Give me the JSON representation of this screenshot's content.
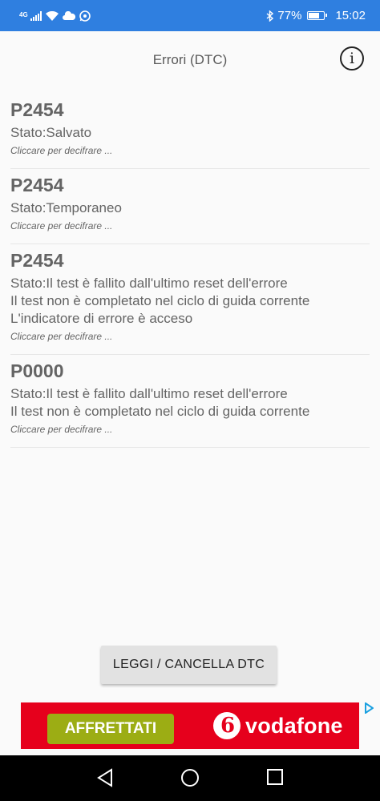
{
  "status_bar": {
    "network_tag": "4G",
    "battery_text": "77%",
    "battery_level": 0.77,
    "time": "15:02",
    "icons": [
      "signal-icon",
      "wifi-icon",
      "cloud-icon",
      "whatsapp-icon",
      "bluetooth-icon",
      "battery-icon"
    ]
  },
  "header": {
    "title": "Errori (DTC)",
    "info_icon": "i"
  },
  "dtc_list": [
    {
      "code": "P2454",
      "status_lines": [
        "Stato:Salvato"
      ],
      "hint": "Cliccare per decifrare ..."
    },
    {
      "code": "P2454",
      "status_lines": [
        "Stato:Temporaneo"
      ],
      "hint": "Cliccare per decifrare ..."
    },
    {
      "code": "P2454",
      "status_lines": [
        "Stato:Il test è fallito dall'ultimo reset dell'errore",
        "Il test non è completato nel ciclo di guida corrente",
        "L'indicatore di errore è acceso"
      ],
      "hint": "Cliccare per decifrare ..."
    },
    {
      "code": "P0000",
      "status_lines": [
        "Stato:Il test è fallito dall'ultimo reset dell'errore",
        "Il test non è completato nel ciclo di guida corrente"
      ],
      "hint": "Cliccare per decifrare ..."
    }
  ],
  "actions": {
    "read_clear_label": "LEGGI / CANCELLA DTC"
  },
  "ad": {
    "cta_label": "AFFRETTATI",
    "brand": "vodafone",
    "brand_mark": "6",
    "bg_color": "#e6001c",
    "cta_color": "#9cad14"
  },
  "nav": {
    "icons": [
      "back-icon",
      "home-icon",
      "recents-icon"
    ]
  }
}
